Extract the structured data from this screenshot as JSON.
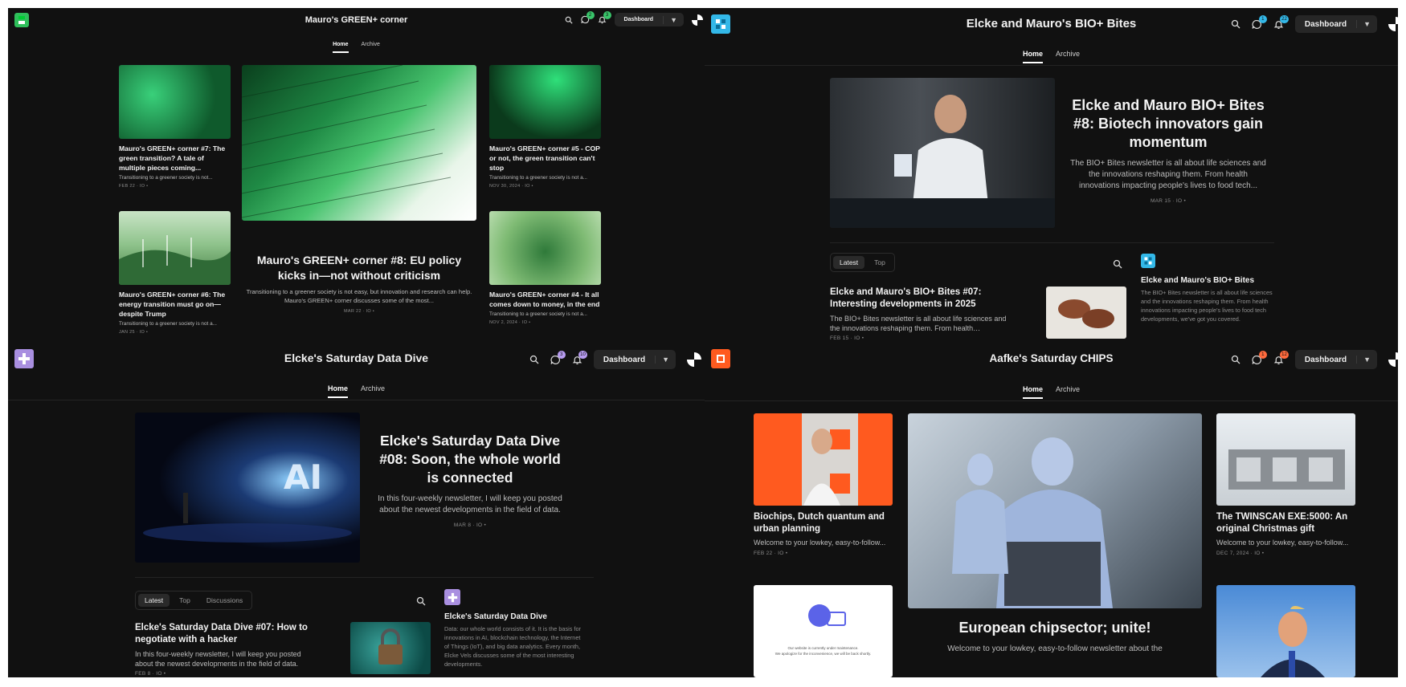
{
  "panels": [
    {
      "title": "Mauro's GREEN+ corner",
      "logo": {
        "icon": "green-plus-logo-icon",
        "color": "#2fbf5b"
      },
      "badges": {
        "chat": "2",
        "bell": "3",
        "color": "#39c46a"
      },
      "dashboard_label": "Dashboard",
      "tabs": [
        "Home",
        "Archive"
      ],
      "featured": {
        "title": "Mauro's GREEN+ corner #8: EU policy kicks in—not without criticism",
        "excerpt": "Transitioning to a greener society is not easy, but innovation and research can help. Mauro's GREEN+ corner discusses some of the most...",
        "meta": "MAR 22 · IO •"
      },
      "posts": [
        {
          "title": "Mauro's GREEN+ corner #7: The green transition? A tale of multiple pieces coming...",
          "excerpt": "Transitioning to a greener society is not...",
          "meta": "FEB 22 · IO •"
        },
        {
          "title": "Mauro's GREEN+ corner #6: The energy transition must go on—despite Trump",
          "excerpt": "Transitioning to a greener society is not a...",
          "meta": "JAN 25 · IO •"
        },
        {
          "title": "Mauro's GREEN+ corner #5 - COP or not, the green transition can't stop",
          "excerpt": "Transitioning to a greener society is not a...",
          "meta": "NOV 30, 2024 · IO •"
        },
        {
          "title": "Mauro's GREEN+ corner #4 - It all comes down to money, in the end",
          "excerpt": "Transitioning to a greener society is not a...",
          "meta": "NOV 2, 2024 · IO •"
        }
      ]
    },
    {
      "title": "Elcke and Mauro's BIO+ Bites",
      "logo": {
        "icon": "bio-plus-logo-icon",
        "color": "#33b8e8"
      },
      "badges": {
        "chat": "1",
        "bell": "22",
        "color": "#33b8e8"
      },
      "dashboard_label": "Dashboard",
      "tabs": [
        "Home",
        "Archive"
      ],
      "featured": {
        "title": "Elcke and Mauro BIO+ Bites #8: Biotech innovators gain momentum",
        "excerpt": "The BIO+ Bites newsletter is all about life sciences and the innovations reshaping them. From health innovations impacting people's lives to food tech...",
        "meta": "MAR 15 · IO •"
      },
      "list_tabs": [
        "Latest",
        "Top"
      ],
      "list_post": {
        "title": "Elcke and Mauro's BIO+ Bites #07: Interesting developments in 2025",
        "excerpt": "The BIO+ Bites newsletter is all about life sciences and the innovations reshaping them. From health innovations...",
        "meta": "FEB 15 · IO •"
      },
      "about": {
        "name": "Elcke and Mauro's BIO+ Bites",
        "text": "The BIO+ Bites newsletter is all about life sciences and the innovations reshaping them. From health innovations impacting people's lives to food tech developments, we've got you covered."
      }
    },
    {
      "title": "Elcke's Saturday Data Dive",
      "logo": {
        "icon": "data-dive-logo-icon",
        "color": "#a98fe0"
      },
      "badges": {
        "chat": "3",
        "bell": "10",
        "color": "#b79cf0"
      },
      "dashboard_label": "Dashboard",
      "tabs": [
        "Home",
        "Archive"
      ],
      "featured": {
        "title": "Elcke's Saturday Data Dive #08: Soon, the whole world is connected",
        "excerpt": "In this four-weekly newsletter, I will keep you posted about the newest developments in the field of data.",
        "meta": "MAR 8 · IO •"
      },
      "list_tabs": [
        "Latest",
        "Top",
        "Discussions"
      ],
      "list_post": {
        "title": "Elcke's Saturday Data Dive #07: How to negotiate with a hacker",
        "excerpt": "In this four-weekly newsletter, I will keep you posted about the newest developments in the field of data.",
        "meta": "FEB 8 · IO •"
      },
      "about": {
        "name": "Elcke's Saturday Data Dive",
        "text": "Data: our whole world consists of it. It is the basis for innovations in AI, blockchain technology, the Internet of Things (IoT), and big data analytics. Every month, Elcke Vels discusses some of the most interesting developments."
      }
    },
    {
      "title": "Aafke's Saturday CHIPS",
      "logo": {
        "icon": "chips-logo-icon",
        "color": "#ff5a1f"
      },
      "badges": {
        "chat": "1",
        "bell": "12",
        "color": "#ff6a3d"
      },
      "dashboard_label": "Dashboard",
      "tabs": [
        "Home",
        "Archive"
      ],
      "featured": {
        "title": "European chipsector; unite!",
        "excerpt": "Welcome to your lowkey, easy-to-follow newsletter about the"
      },
      "posts": [
        {
          "title": "Biochips, Dutch quantum and urban planning",
          "excerpt": "Welcome to your lowkey, easy-to-follow...",
          "meta": "FEB 22 · IO •"
        },
        {
          "title": "The TWINSCAN EXE:5000: An original Christmas gift",
          "excerpt": "Welcome to your lowkey, easy-to-follow...",
          "meta": "DEC 7, 2024 · IO •"
        }
      ],
      "maintenance": {
        "line1": "Our website is currently under maintenance.",
        "line2": "We apologize for the inconvenience, we will be back shortly."
      }
    }
  ]
}
